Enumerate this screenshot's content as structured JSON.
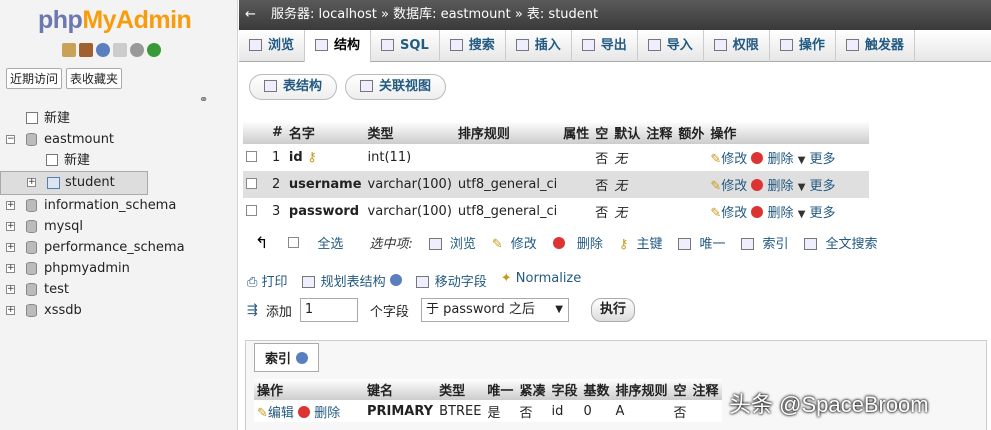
{
  "sidebar": {
    "logo_a": "php",
    "logo_b": "MyAdmin",
    "tab_recent": "近期访问",
    "tab_favorites": "表收藏夹",
    "tree": [
      {
        "label": "新建",
        "level": 0,
        "expander": "",
        "icon": "new"
      },
      {
        "label": "eastmount",
        "level": 0,
        "expander": "−",
        "icon": "db"
      },
      {
        "label": "新建",
        "level": 1,
        "expander": "",
        "icon": "new"
      },
      {
        "label": "student",
        "level": 1,
        "expander": "+",
        "icon": "table",
        "selected": true
      },
      {
        "label": "information_schema",
        "level": 0,
        "expander": "+",
        "icon": "db"
      },
      {
        "label": "mysql",
        "level": 0,
        "expander": "+",
        "icon": "db"
      },
      {
        "label": "performance_schema",
        "level": 0,
        "expander": "+",
        "icon": "db"
      },
      {
        "label": "phpmyadmin",
        "level": 0,
        "expander": "+",
        "icon": "db"
      },
      {
        "label": "test",
        "level": 0,
        "expander": "+",
        "icon": "db"
      },
      {
        "label": "xssdb",
        "level": 0,
        "expander": "+",
        "icon": "db"
      }
    ]
  },
  "topbar": {
    "back": "←",
    "server_label": "服务器: localhost",
    "sep": "»",
    "db_label": "数据库: eastmount",
    "table_label": "表: student"
  },
  "menu": [
    "浏览",
    "结构",
    "SQL",
    "搜索",
    "插入",
    "导出",
    "导入",
    "权限",
    "操作",
    "触发器"
  ],
  "subtabs": [
    "表结构",
    "关联视图"
  ],
  "fields_table": {
    "headers": [
      "#",
      "名字",
      "类型",
      "排序规则",
      "属性",
      "空",
      "默认",
      "注释",
      "额外",
      "操作"
    ],
    "rows": [
      {
        "num": "1",
        "name": "id",
        "key": true,
        "type": "int(11)",
        "collation": "",
        "null": "否",
        "default": "无"
      },
      {
        "num": "2",
        "name": "username",
        "key": false,
        "type": "varchar(100)",
        "collation": "utf8_general_ci",
        "null": "否",
        "default": "无"
      },
      {
        "num": "3",
        "name": "password",
        "key": false,
        "type": "varchar(100)",
        "collation": "utf8_general_ci",
        "null": "否",
        "default": "无"
      }
    ],
    "action_edit": "修改",
    "action_delete": "删除",
    "action_more": "更多"
  },
  "bulk": {
    "check_all": "全选",
    "with_selected": "选中项:",
    "browse": "浏览",
    "edit": "修改",
    "delete": "删除",
    "primary": "主键",
    "unique": "唯一",
    "index": "索引",
    "fulltext": "全文搜索"
  },
  "actions2": {
    "print": "打印",
    "plan": "规划表结构",
    "move": "移动字段",
    "normalize": "Normalize"
  },
  "add_row": {
    "label": "添加",
    "count": "1",
    "unit": "个字段",
    "position": "于 password 之后",
    "go": "执行"
  },
  "index": {
    "legend": "索引",
    "headers": [
      "操作",
      "键名",
      "类型",
      "唯一",
      "紧凑",
      "字段",
      "基数",
      "排序规则",
      "空",
      "注释"
    ],
    "row": {
      "edit": "编辑",
      "delete": "删除",
      "keyname": "PRIMARY",
      "type": "BTREE",
      "unique": "是",
      "packed": "否",
      "column": "id",
      "cardinality": "0",
      "collation": "A",
      "null": "否",
      "comment": ""
    }
  },
  "watermark": "头条 @SpaceBroom"
}
